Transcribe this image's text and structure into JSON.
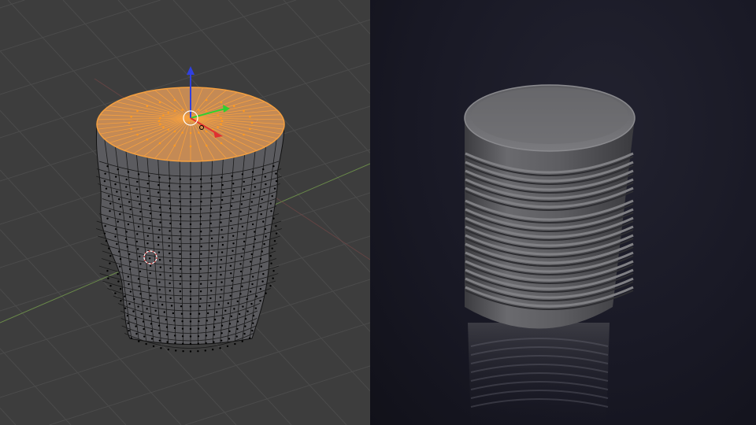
{
  "viewport": {
    "mode": "edit-mode",
    "background_color": "#3d3d3d",
    "grid_color": "#4a4a4a",
    "x_axis_color": "#7a3a3a",
    "y_axis_color": "#3f7a3a",
    "selection_color": "#f5a040",
    "gizmo": {
      "x_color": "#e03030",
      "y_color": "#30d030",
      "z_color": "#3040e0"
    },
    "icons": [
      "transform-gizmo-icon",
      "3d-cursor-icon"
    ]
  },
  "render": {
    "background_color": "#181824",
    "object": "ribbed-barrel",
    "object_color": "#5a5a5e"
  }
}
